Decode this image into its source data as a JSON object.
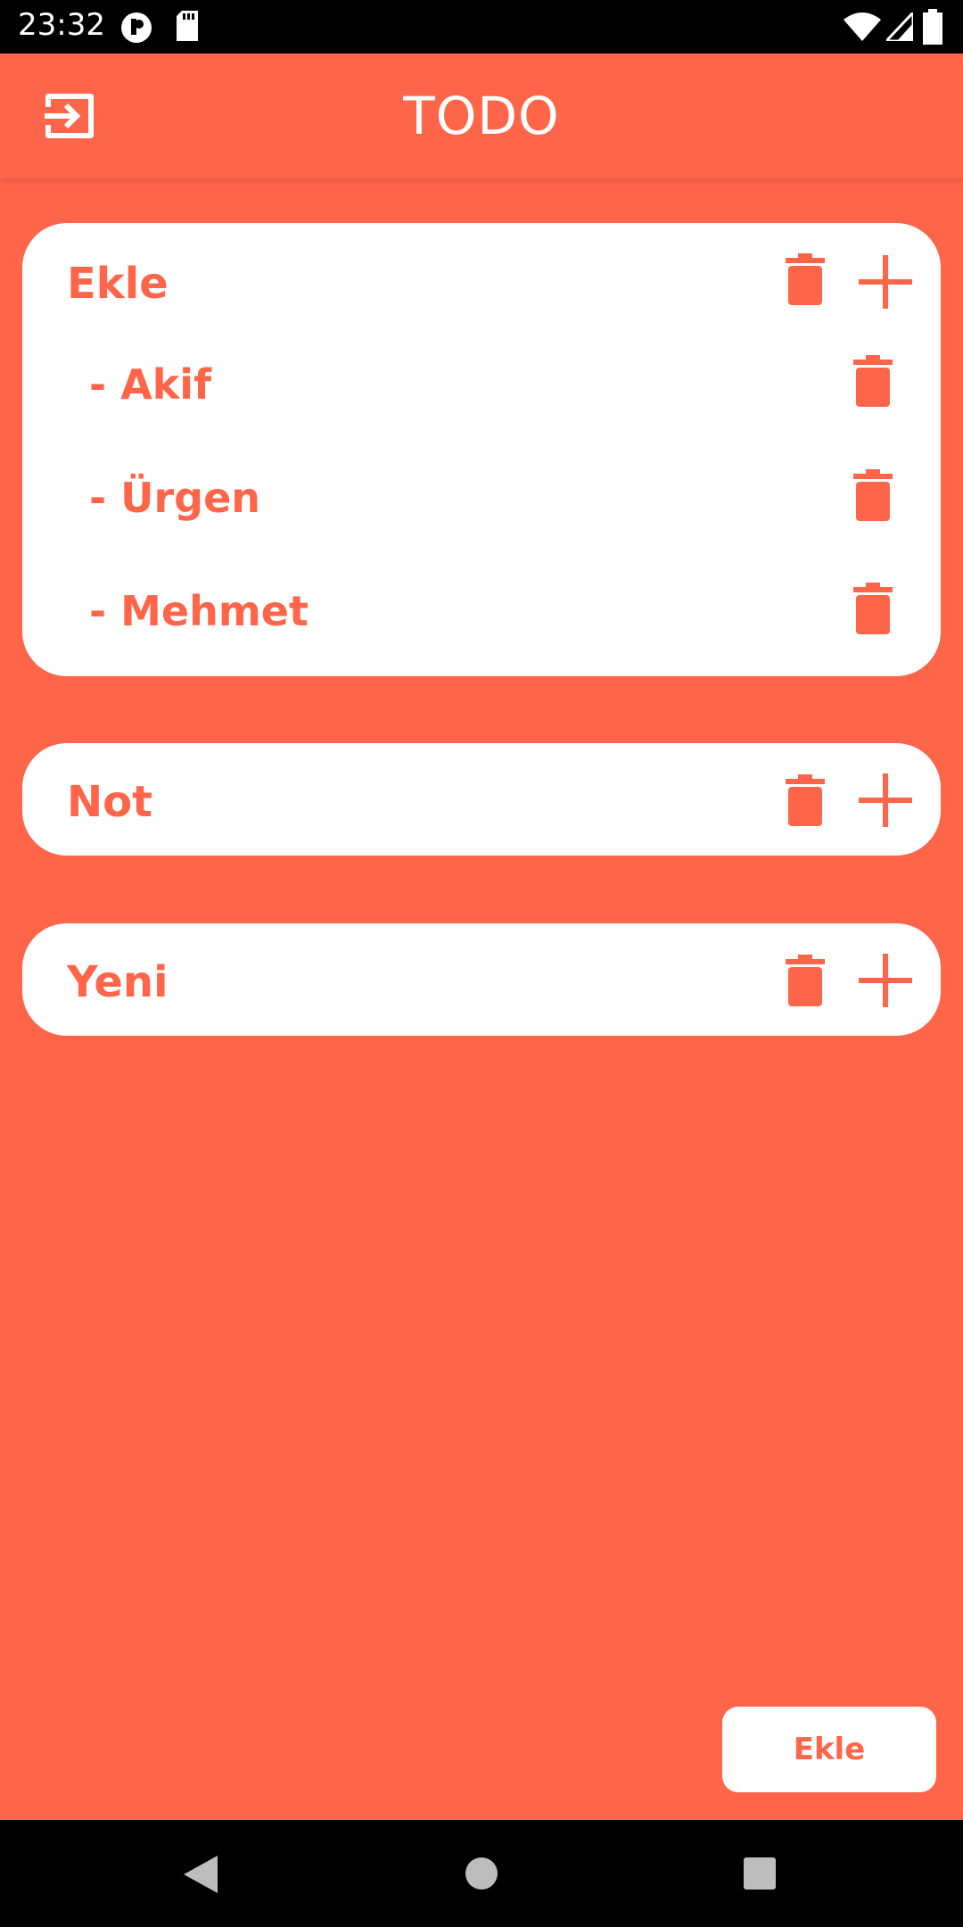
{
  "status_bar": {
    "time": "23:32",
    "icons": [
      "data-saver-icon",
      "sd-card-icon",
      "wifi-icon",
      "signal-icon",
      "battery-icon"
    ]
  },
  "app_bar": {
    "title": "TODO",
    "leading_icon": "exit-to-app-icon"
  },
  "lists": [
    {
      "title": "Ekle",
      "items": [
        {
          "label": "- Akif"
        },
        {
          "label": "- Ürgen"
        },
        {
          "label": "- Mehmet"
        }
      ]
    },
    {
      "title": "Not",
      "items": []
    },
    {
      "title": "Yeni",
      "items": []
    }
  ],
  "add_button": {
    "label": "Ekle"
  },
  "colors": {
    "accent": "#FF6549",
    "card": "#FFFFFF"
  },
  "nav_bar": {
    "icons": [
      "back-icon",
      "home-icon",
      "recents-icon"
    ]
  }
}
